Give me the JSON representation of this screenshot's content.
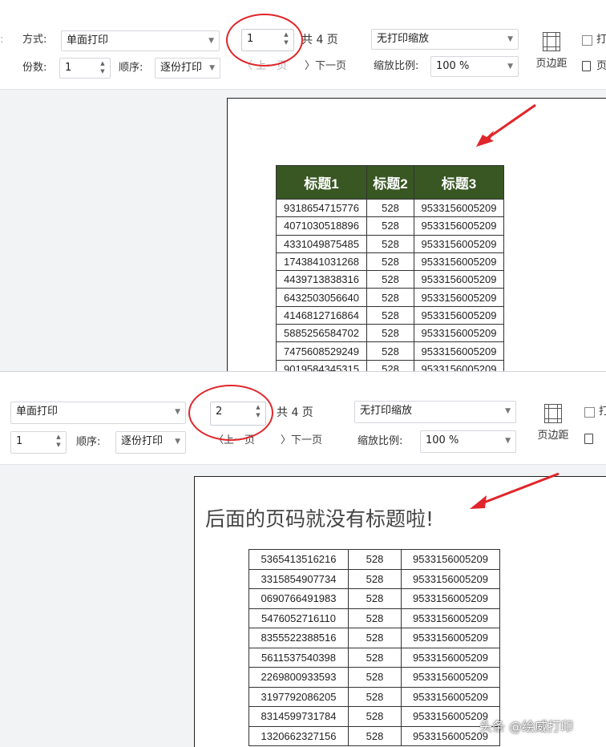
{
  "screen1": {
    "toolbar": {
      "mode_label": "方式:",
      "mode_value": "单面打印",
      "copies_label": "份数:",
      "copies_value": "1",
      "order_label": "顺序:",
      "order_value": "逐份打印",
      "page_value": "1",
      "total_pages": "共 4 页",
      "prev_page": "上一页",
      "next_page": "下一页",
      "scale_mode": "无打印缩放",
      "zoom_label": "缩放比例:",
      "zoom_value": "100 %",
      "margins_label": "页边距",
      "partial_right_1": "打",
      "partial_right_2": "页"
    },
    "table": {
      "headers": [
        "标题1",
        "标题2",
        "标题3"
      ],
      "rows": [
        [
          "9318654715776",
          "528",
          "9533156005209"
        ],
        [
          "4071030518896",
          "528",
          "9533156005209"
        ],
        [
          "4331049875485",
          "528",
          "9533156005209"
        ],
        [
          "1743841031268",
          "528",
          "9533156005209"
        ],
        [
          "4439713838316",
          "528",
          "9533156005209"
        ],
        [
          "6432503056640",
          "528",
          "9533156005209"
        ],
        [
          "4146812716864",
          "528",
          "9533156005209"
        ],
        [
          "5885256584702",
          "528",
          "9533156005209"
        ],
        [
          "7475608529249",
          "528",
          "9533156005209"
        ],
        [
          "9019584345315",
          "528",
          "9533156005209"
        ]
      ]
    }
  },
  "screen2": {
    "toolbar": {
      "mode_value": "单面打印",
      "copies_value": "1",
      "order_label": "顺序:",
      "order_value": "逐份打印",
      "page_value": "2",
      "total_pages": "共 4 页",
      "prev_page": "上一页",
      "next_page": "下一页",
      "scale_mode": "无打印缩放",
      "zoom_label": "缩放比例:",
      "zoom_value": "100 %",
      "margins_label": "页边距",
      "partial_right_1": "打"
    },
    "annotation": "后面的页码就没有标题啦!",
    "table": {
      "rows": [
        [
          "5365413516216",
          "528",
          "9533156005209"
        ],
        [
          "3315854907734",
          "528",
          "9533156005209"
        ],
        [
          "0690766491983",
          "528",
          "9533156005209"
        ],
        [
          "5476052716110",
          "528",
          "9533156005209"
        ],
        [
          "8355522388516",
          "528",
          "9533156005209"
        ],
        [
          "5611537540398",
          "528",
          "9533156005209"
        ],
        [
          "2269800933593",
          "528",
          "9533156005209"
        ],
        [
          "3197792086205",
          "528",
          "9533156005209"
        ],
        [
          "8314599731784",
          "528",
          "9533156005209"
        ],
        [
          "1320662327156",
          "528",
          "9533156005209"
        ]
      ]
    }
  },
  "watermark": "头条 @绘威打印",
  "colors": {
    "header_bg": "#385723",
    "annotation_red": "#e0262b",
    "preview_bg": "#f2f3f5"
  }
}
